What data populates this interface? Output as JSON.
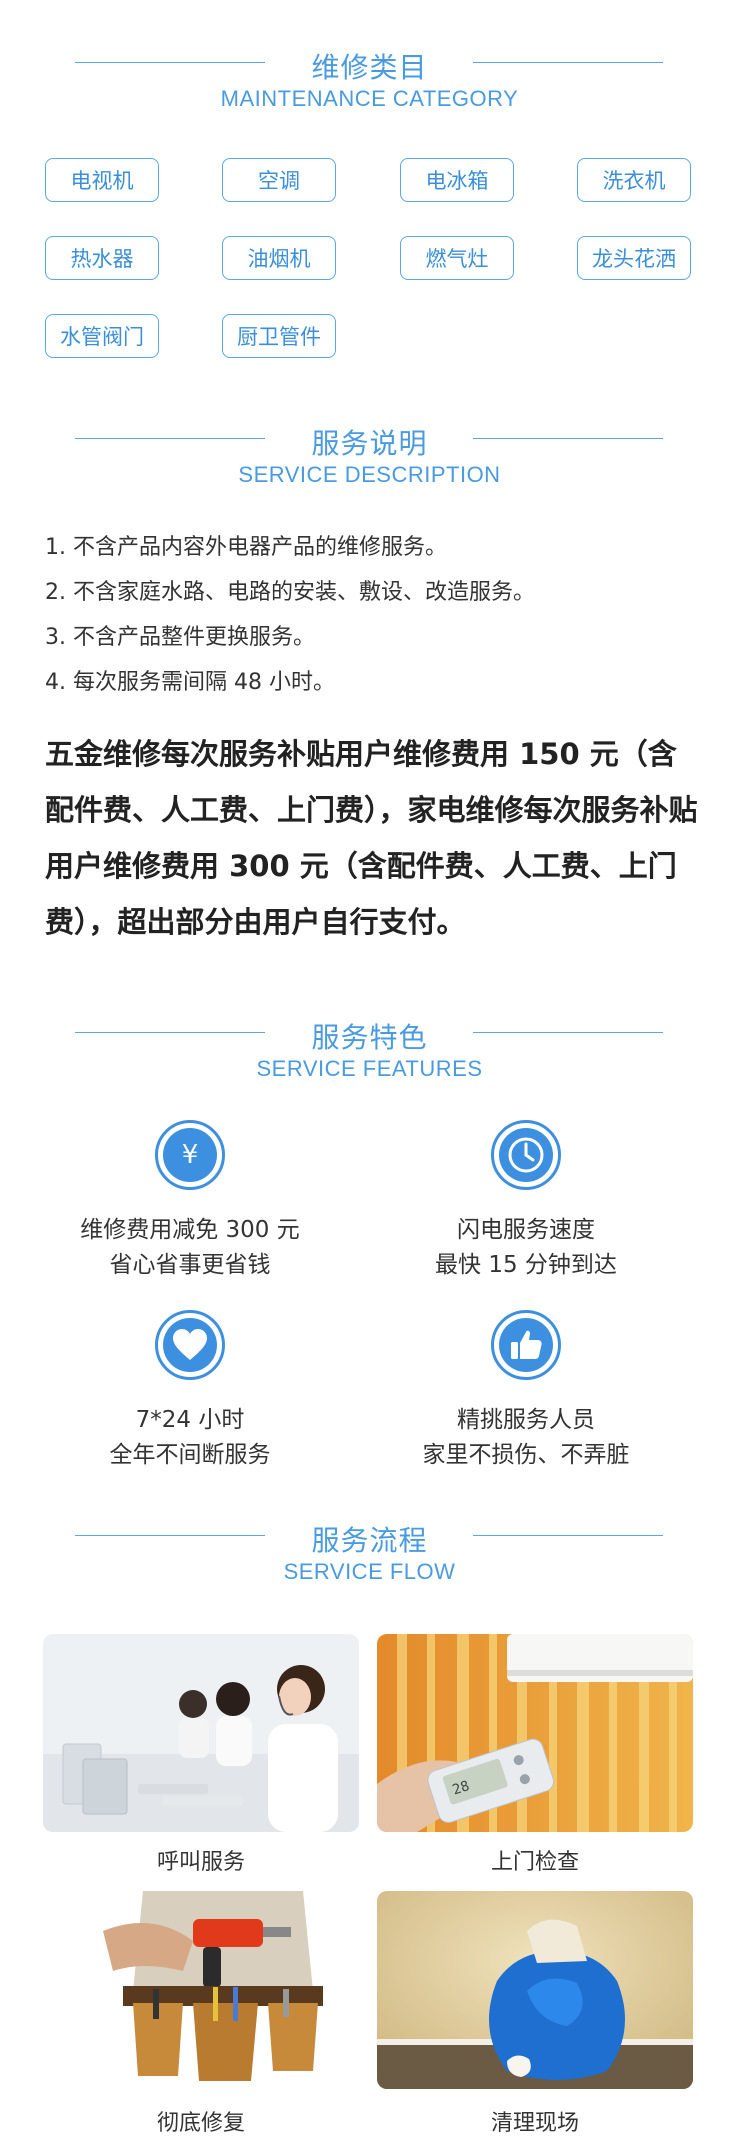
{
  "category": {
    "title": "维修类目",
    "subtitle": "MAINTENANCE CATEGORY",
    "tags": [
      "电视机",
      "空调",
      "电冰箱",
      "洗衣机",
      "热水器",
      "油烟机",
      "燃气灶",
      "龙头花洒",
      "水管阀门",
      "厨卫管件"
    ]
  },
  "description": {
    "title": "服务说明",
    "subtitle": "SERVICE DESCRIPTION",
    "items": [
      "1. 不含产品内容外电器产品的维修服务。",
      "2. 不含家庭水路、电路的安装、敷设、改造服务。",
      "3. 不含产品整件更换服务。",
      "4. 每次服务需间隔 48 小时。"
    ],
    "subsidy": "五金维修每次服务补贴用户维修费用 150 元（含配件费、人工费、上门费），家电维修每次服务补贴用户维修费用 300 元（含配件费、人工费、上门费），超出部分由用户自行支付。"
  },
  "features": {
    "title": "服务特色",
    "subtitle": "SERVICE FEATURES",
    "items": [
      {
        "icon": "yen-icon",
        "glyph": "¥",
        "line1": "维修费用减免 300 元",
        "line2": "省心省事更省钱"
      },
      {
        "icon": "clock-icon",
        "glyph": "",
        "line1": "闪电服务速度",
        "line2": "最快 15 分钟到达"
      },
      {
        "icon": "heart-icon",
        "glyph": "",
        "line1": "7*24 小时",
        "line2": "全年不间断服务"
      },
      {
        "icon": "thumbs-up-icon",
        "glyph": "",
        "line1": "精挑服务人员",
        "line2": "家里不损伤、不弄脏"
      }
    ]
  },
  "flow": {
    "title": "服务流程",
    "subtitle": "SERVICE FLOW",
    "steps": [
      {
        "label": "呼叫服务",
        "image": "call-center-photo"
      },
      {
        "label": "上门检查",
        "image": "inspection-photo"
      },
      {
        "label": "彻底修复",
        "image": "repair-photo"
      },
      {
        "label": "清理现场",
        "image": "cleanup-photo"
      }
    ]
  },
  "colors": {
    "accent": "#4a9ae0",
    "icon_blue": "#3d8fe0",
    "text": "#333333"
  }
}
